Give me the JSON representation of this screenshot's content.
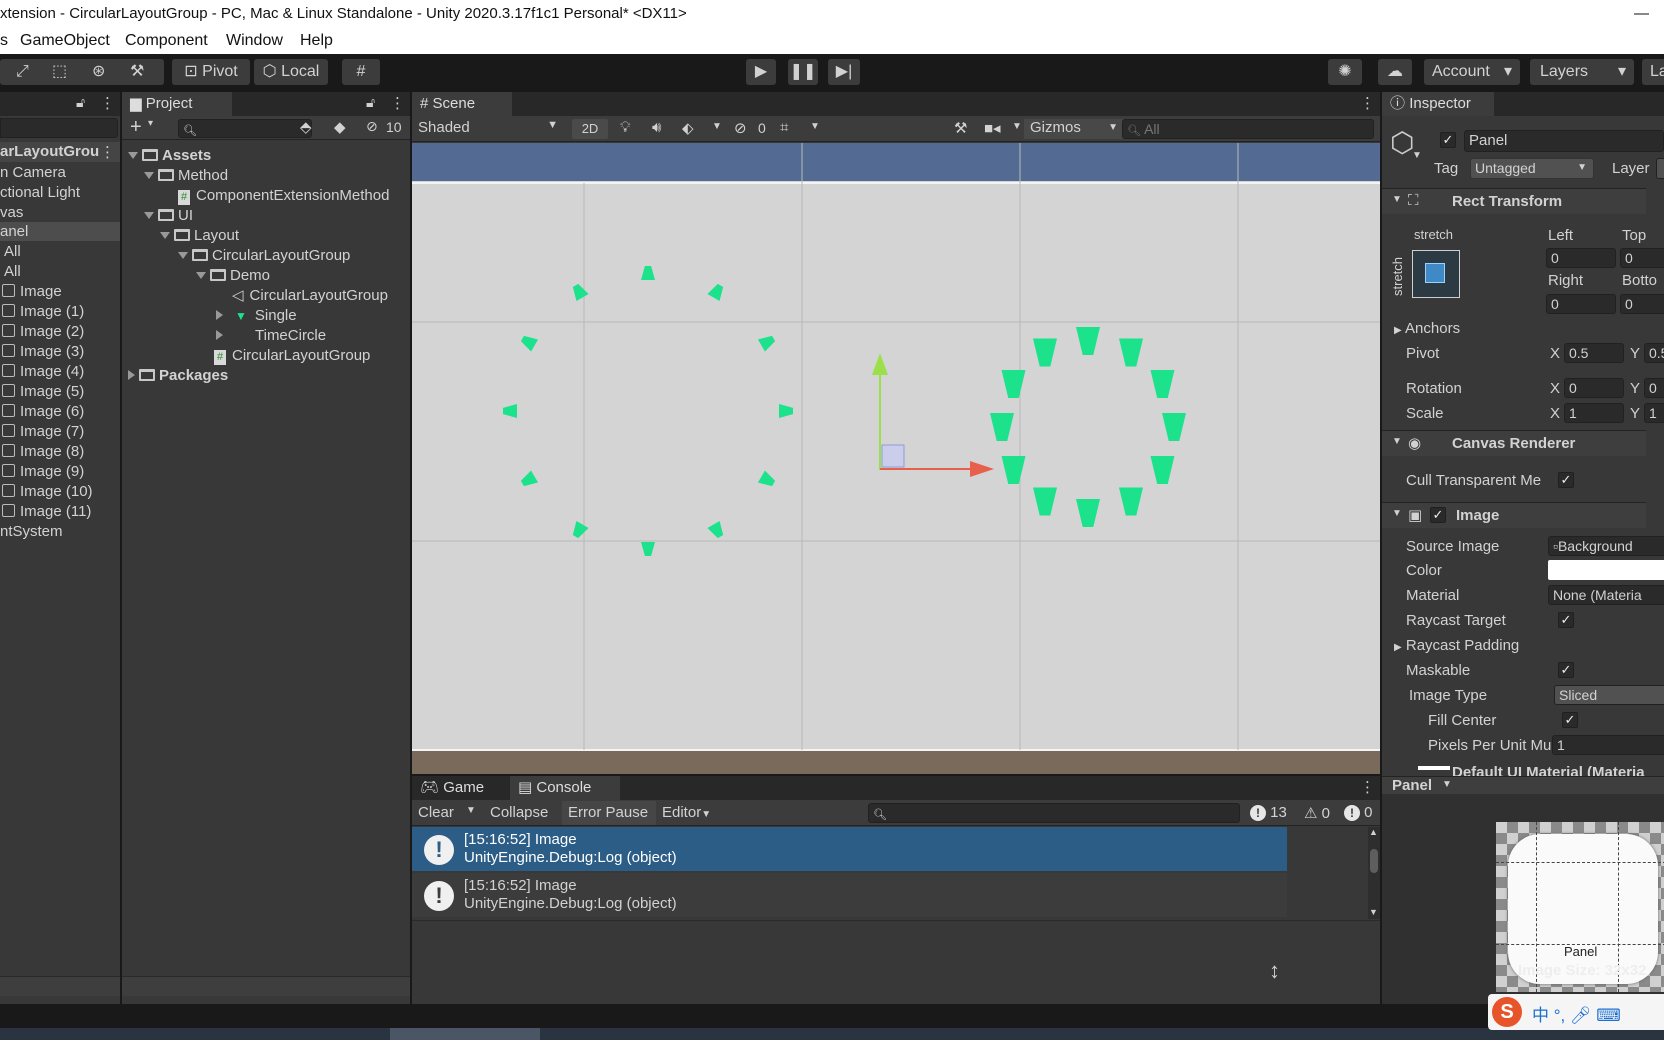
{
  "window": {
    "title": "xtension - CircularLayoutGroup - PC, Mac & Linux Standalone - Unity 2020.3.17f1c1 Personal* <DX11>",
    "minimize": "—"
  },
  "menu": [
    "s",
    "GameObject",
    "Component",
    "Window",
    "Help"
  ],
  "toolbar": {
    "pivot": "Pivot",
    "local": "Local",
    "account": "Account",
    "layers": "Layers",
    "layout_partial": "La"
  },
  "hierarchy": {
    "root": "arLayoutGrou",
    "items": [
      "n Camera",
      "ctional Light",
      "vas",
      "anel",
      "All",
      "All",
      "Image",
      "Image (1)",
      "Image (2)",
      "Image (3)",
      "Image (4)",
      "Image (5)",
      "Image (6)",
      "Image (7)",
      "Image (8)",
      "Image (9)",
      "Image (10)",
      "Image (11)",
      "ntSystem"
    ]
  },
  "project": {
    "tab": "Project",
    "hidden_count": "10",
    "tree": [
      "Assets",
      "Method",
      "ComponentExtensionMethod",
      "UI",
      "Layout",
      "CircularLayoutGroup",
      "Demo",
      "CircularLayoutGroup",
      "Single",
      "TimeCircle",
      "CircularLayoutGroup",
      "Packages"
    ]
  },
  "scene": {
    "tab": "Scene",
    "shading": "Shaded",
    "mode2d": "2D",
    "hidden": "0",
    "gizmos": "Gizmos",
    "search_placeholder": "All"
  },
  "bottom": {
    "tabs": [
      "Game",
      "Console"
    ],
    "buttons": [
      "Clear",
      "Collapse",
      "Error Pause",
      "Editor"
    ],
    "counts": {
      "log": "13",
      "warn": "0",
      "err": "0"
    },
    "logs": [
      {
        "line1": "[15:16:52] Image",
        "line2": "UnityEngine.Debug:Log (object)"
      },
      {
        "line1": "[15:16:52] Image",
        "line2": "UnityEngine.Debug:Log (object)"
      }
    ]
  },
  "inspector": {
    "tab": "Inspector",
    "name": "Panel",
    "tag_label": "Tag",
    "tag": "Untagged",
    "layer_label": "Layer",
    "rect_transform": "Rect Transform",
    "stretch": "stretch",
    "left_label": "Left",
    "left": "0",
    "top_label": "Top",
    "top": "0",
    "right_label": "Right",
    "right": "0",
    "bottom_label": "Botto",
    "bottom": "0",
    "anchors": "Anchors",
    "pivot_label": "Pivot",
    "pivot_x": "0.5",
    "pivot_y": "0.5",
    "rotation_label": "Rotation",
    "rot_x": "0",
    "rot_y": "0",
    "scale_label": "Scale",
    "scale_x": "1",
    "scale_y": "1",
    "canvas_renderer": "Canvas Renderer",
    "cull": "Cull Transparent Me:",
    "image": "Image",
    "source_image_label": "Source Image",
    "source_image": "Background",
    "color_label": "Color",
    "material_label": "Material",
    "material": "None (Materia",
    "raycast_target": "Raycast Target",
    "raycast_padding": "Raycast Padding",
    "maskable": "Maskable",
    "image_type_label": "Image Type",
    "image_type": "Sliced",
    "fill_center": "Fill Center",
    "ppu_label": "Pixels Per Unit Mu",
    "ppu": "1",
    "default_material": "Default UI Material (Materia",
    "preview_title": "Panel",
    "preview_label": "Panel",
    "preview_size": "Image Size: 32x32"
  },
  "axis_labels": {
    "x": "X",
    "y": "Y"
  },
  "colors": {
    "accent_selected": "#2c5d87",
    "marker_green": "#1de28c"
  }
}
